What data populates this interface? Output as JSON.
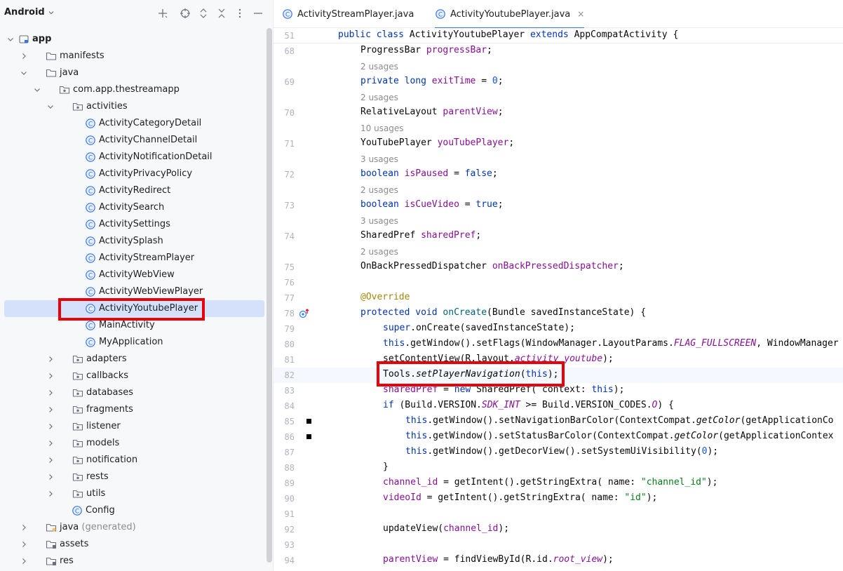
{
  "project_panel": {
    "title": "Android",
    "header_icons": [
      "add-icon",
      "target-icon",
      "expand-collapse-icon",
      "close-icon",
      "more-vertical-icon",
      "minimize-icon"
    ],
    "tree": [
      {
        "label": "app",
        "type": "module",
        "depth": 0,
        "expanded": true,
        "bold": true
      },
      {
        "label": "manifests",
        "type": "folder",
        "depth": 1,
        "expanded": false
      },
      {
        "label": "java",
        "type": "folder",
        "depth": 1,
        "expanded": true
      },
      {
        "label": "com.app.thestreamapp",
        "type": "package",
        "depth": 2,
        "expanded": true
      },
      {
        "label": "activities",
        "type": "package",
        "depth": 3,
        "expanded": true
      },
      {
        "label": "ActivityCategoryDetail",
        "type": "class",
        "depth": 4
      },
      {
        "label": "ActivityChannelDetail",
        "type": "class",
        "depth": 4
      },
      {
        "label": "ActivityNotificationDetail",
        "type": "class",
        "depth": 4
      },
      {
        "label": "ActivityPrivacyPolicy",
        "type": "class",
        "depth": 4
      },
      {
        "label": "ActivityRedirect",
        "type": "class",
        "depth": 4
      },
      {
        "label": "ActivitySearch",
        "type": "class",
        "depth": 4
      },
      {
        "label": "ActivitySettings",
        "type": "class",
        "depth": 4
      },
      {
        "label": "ActivitySplash",
        "type": "class",
        "depth": 4
      },
      {
        "label": "ActivityStreamPlayer",
        "type": "class",
        "depth": 4
      },
      {
        "label": "ActivityWebView",
        "type": "class",
        "depth": 4
      },
      {
        "label": "ActivityWebViewPlayer",
        "type": "class",
        "depth": 4
      },
      {
        "label": "ActivityYoutubePlayer",
        "type": "class",
        "depth": 4,
        "selected": true
      },
      {
        "label": "MainActivity",
        "type": "class",
        "depth": 4
      },
      {
        "label": "MyApplication",
        "type": "class",
        "depth": 4
      },
      {
        "label": "adapters",
        "type": "package",
        "depth": 3,
        "expanded": false
      },
      {
        "label": "callbacks",
        "type": "package",
        "depth": 3,
        "expanded": false
      },
      {
        "label": "databases",
        "type": "package",
        "depth": 3,
        "expanded": false
      },
      {
        "label": "fragments",
        "type": "package",
        "depth": 3,
        "expanded": false
      },
      {
        "label": "listener",
        "type": "package",
        "depth": 3,
        "expanded": false
      },
      {
        "label": "models",
        "type": "package",
        "depth": 3,
        "expanded": false
      },
      {
        "label": "notification",
        "type": "package",
        "depth": 3,
        "expanded": false
      },
      {
        "label": "rests",
        "type": "package",
        "depth": 3,
        "expanded": false
      },
      {
        "label": "utils",
        "type": "package",
        "depth": 3,
        "expanded": false
      },
      {
        "label": "Config",
        "type": "class",
        "depth": 3
      },
      {
        "label": "java",
        "suffix": "(generated)",
        "type": "folder-gen",
        "depth": 1,
        "expanded": false
      },
      {
        "label": "assets",
        "type": "folder-res",
        "depth": 1,
        "expanded": false
      },
      {
        "label": "res",
        "type": "folder-res",
        "depth": 1,
        "expanded": false
      }
    ]
  },
  "editor": {
    "tabs": [
      {
        "label": "ActivityStreamPlayer.java",
        "active": false
      },
      {
        "label": "ActivityYoutubePlayer.java",
        "active": true,
        "close": "×"
      }
    ],
    "sticky_line": {
      "num": "51",
      "text": "public class ActivityYoutubePlayer extends AppCompatActivity {"
    },
    "lines": [
      {
        "num": "68",
        "text": "ProgressBar progressBar;",
        "indent": 1
      },
      {
        "hint": "2 usages"
      },
      {
        "num": "69",
        "text": "private long exitTime = 0;",
        "indent": 1
      },
      {
        "hint": "2 usages"
      },
      {
        "num": "70",
        "text": "RelativeLayout parentView;",
        "indent": 1
      },
      {
        "hint": "10 usages"
      },
      {
        "num": "71",
        "text": "YouTubePlayer youTubePlayer;",
        "indent": 1
      },
      {
        "hint": "3 usages"
      },
      {
        "num": "72",
        "text": "boolean isPaused = false;",
        "indent": 1
      },
      {
        "hint": "2 usages"
      },
      {
        "num": "73",
        "text": "boolean isCueVideo = true;",
        "indent": 1
      },
      {
        "hint": "3 usages"
      },
      {
        "num": "74",
        "text": "SharedPref sharedPref;",
        "indent": 1
      },
      {
        "hint": "2 usages"
      },
      {
        "num": "75",
        "text": "OnBackPressedDispatcher onBackPressedDispatcher;",
        "indent": 1
      },
      {
        "num": "76",
        "text": ""
      },
      {
        "num": "77",
        "text": "@Override",
        "indent": 1
      },
      {
        "num": "78",
        "text": "protected void onCreate(Bundle savedInstanceState) {",
        "indent": 1
      },
      {
        "num": "79",
        "text": "super.onCreate(savedInstanceState);",
        "indent": 2
      },
      {
        "num": "80",
        "text": "this.getWindow().setFlags(WindowManager.LayoutParams.FLAG_FULLSCREEN, WindowManager",
        "indent": 2
      },
      {
        "num": "81",
        "text": "setContentView(R.layout.activity_youtube);",
        "indent": 2
      },
      {
        "num": "82",
        "text": "Tools.setPlayerNavigation(this);",
        "indent": 2
      },
      {
        "num": "83",
        "text": "sharedPref = new SharedPref( context: this);",
        "indent": 2
      },
      {
        "num": "84",
        "text": "if (Build.VERSION.SDK_INT >= Build.VERSION_CODES.O) {",
        "indent": 2
      },
      {
        "num": "85",
        "text": "this.getWindow().setNavigationBarColor(ContextCompat.getColor(getApplicationCo",
        "indent": 3
      },
      {
        "num": "86",
        "text": "this.getWindow().setStatusBarColor(ContextCompat.getColor(getApplicationContex",
        "indent": 3
      },
      {
        "num": "87",
        "text": "this.getWindow().getDecorView().setSystemUiVisibility(0);",
        "indent": 3
      },
      {
        "num": "88",
        "text": "}",
        "indent": 2
      },
      {
        "num": "89",
        "text": "channel_id = getIntent().getStringExtra( name: \"channel_id\");",
        "indent": 2
      },
      {
        "num": "90",
        "text": "videoId = getIntent().getStringExtra( name: \"id\");",
        "indent": 2
      },
      {
        "num": "91",
        "text": ""
      },
      {
        "num": "92",
        "text": "updateView(channel_id);",
        "indent": 2
      },
      {
        "num": "93",
        "text": ""
      },
      {
        "num": "94",
        "text": "parentView = findViewById(R.id.root_view);",
        "indent": 2
      }
    ],
    "inlay_hints": {
      "context": "context:",
      "name": "name:"
    }
  },
  "colors": {
    "highlight_box": "#e8000b",
    "selection": "#d5e1fb",
    "accent": "#3574f0"
  }
}
